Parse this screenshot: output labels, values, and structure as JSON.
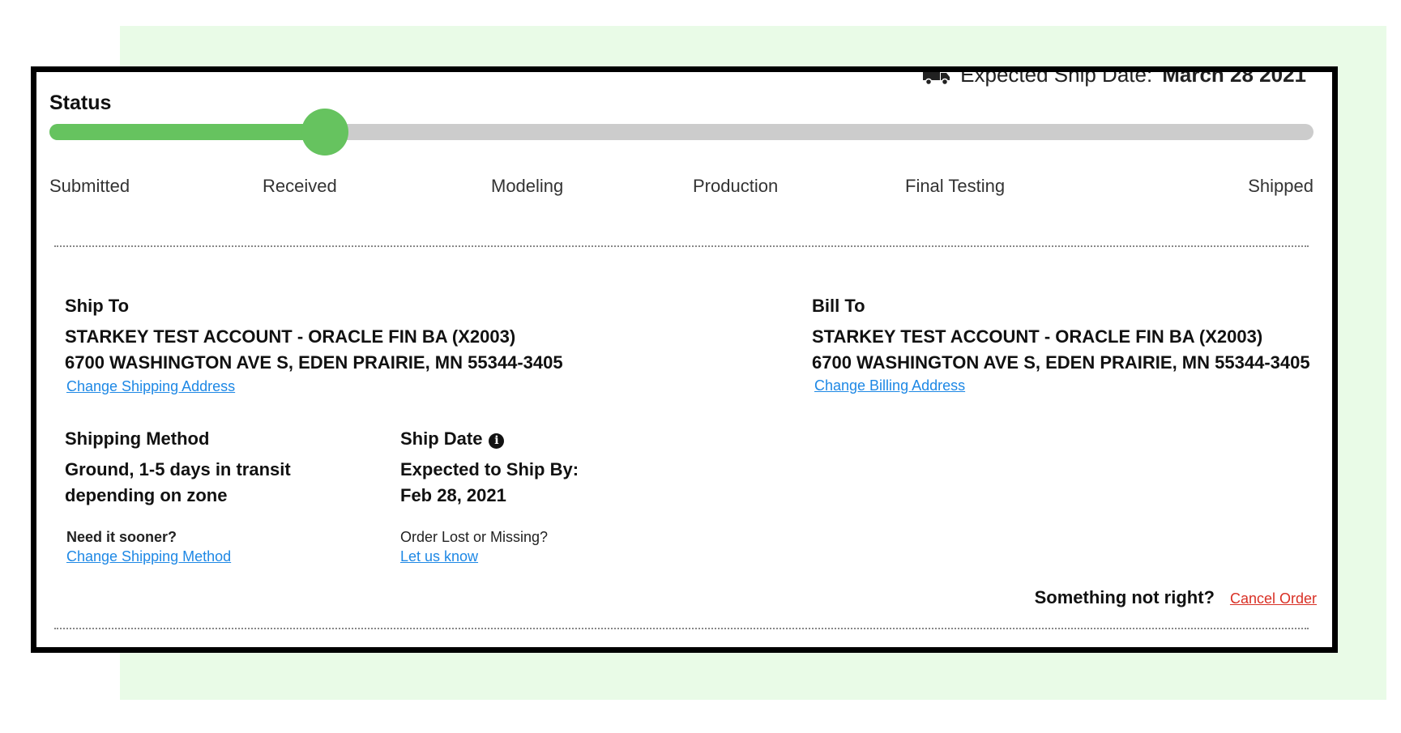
{
  "banner": {
    "label": "Expected Ship Date:",
    "date": "March 28 2021"
  },
  "status": {
    "title": "Status",
    "progress_fraction": 0.218,
    "colors": {
      "filled": "#66c35f",
      "track": "#cccccc"
    },
    "steps": [
      "Submitted",
      "Received",
      "Modeling",
      "Production",
      "Final Testing",
      "Shipped"
    ]
  },
  "ship_to": {
    "label": "Ship To",
    "name": "STARKEY TEST ACCOUNT - ORACLE FIN BA (X2003)",
    "address": "6700 WASHINGTON AVE S, EDEN PRAIRIE, MN 55344-3405",
    "change_link": "Change Shipping Address"
  },
  "bill_to": {
    "label": "Bill To",
    "name": "STARKEY TEST ACCOUNT - ORACLE FIN BA (X2003)",
    "address": "6700 WASHINGTON AVE S, EDEN PRAIRIE, MN 55344-3405",
    "change_link": "Change Billing Address"
  },
  "shipping_method": {
    "label": "Shipping Method",
    "line1": "Ground, 1-5 days in transit",
    "line2": "depending on zone",
    "sooner_prompt": "Need it sooner?",
    "change_link": "Change Shipping Method"
  },
  "ship_date": {
    "label": "Ship Date",
    "info_icon": "i",
    "line1": "Expected to Ship By:",
    "line2": "Feb 28, 2021",
    "lost_prompt": "Order Lost or Missing?",
    "lost_link": "Let us know"
  },
  "cancel": {
    "prompt": "Something not right?",
    "link": "Cancel Order"
  }
}
